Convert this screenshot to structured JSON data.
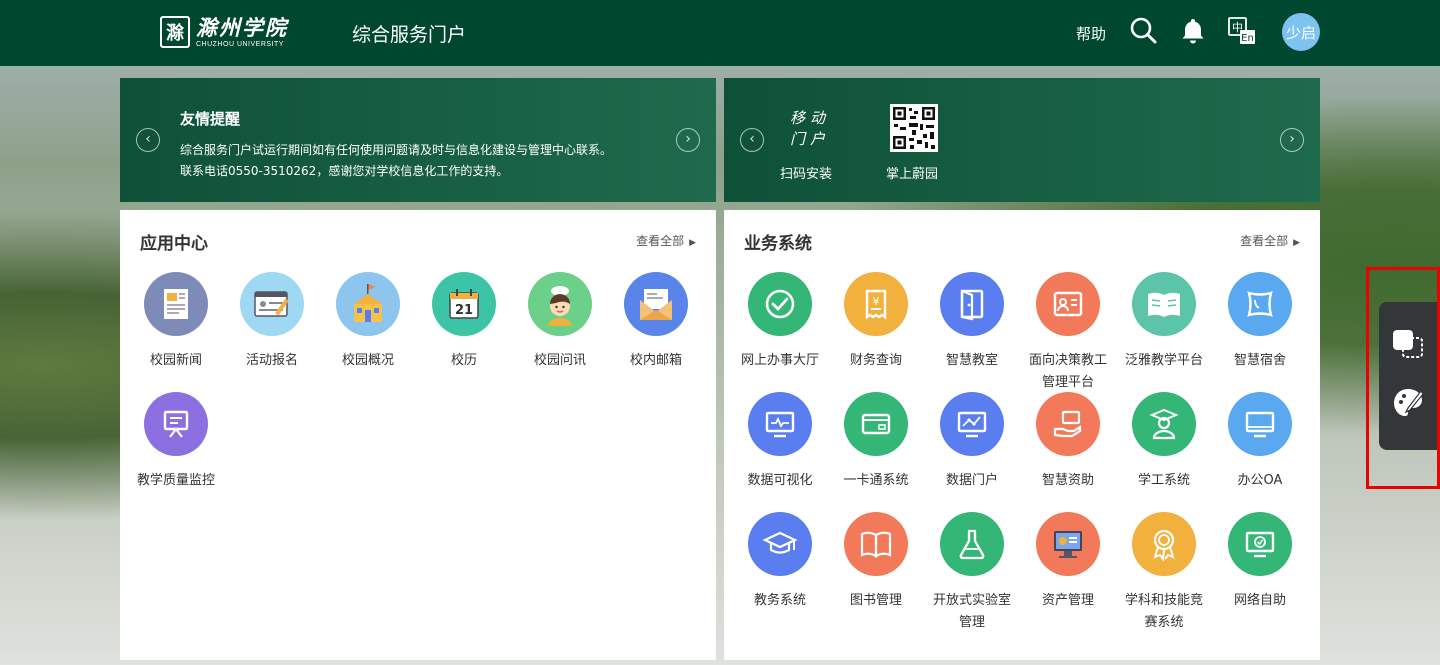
{
  "header": {
    "logo_cn": "滁州学院",
    "logo_en": "CHUZHOU UNIVERSITY",
    "logo_seal": "滁",
    "portal_title": "综合服务门户",
    "help": "帮助",
    "user_avatar": "少启",
    "icons": [
      "search-icon",
      "bell-icon",
      "language-icon"
    ]
  },
  "notice": {
    "title": "友情提醒",
    "line1": "综合服务门户试运行期间如有任何使用问题请及时与信息化建设与管理中心联系。",
    "line2": "联系电话0550-3510262，感谢您对学校信息化工作的支持。"
  },
  "mobile": {
    "slogan_line1": "移动",
    "slogan_line2": "门户",
    "scan_caption": "扫码安装",
    "app_caption": "掌上蔚园"
  },
  "app_center": {
    "title": "应用中心",
    "view_all": "查看全部",
    "apps": [
      {
        "label": "校园新闻",
        "icon": "newspaper-icon",
        "color": "#7e8ab8"
      },
      {
        "label": "活动报名",
        "icon": "signup-form-icon",
        "color": "#9fd8f2"
      },
      {
        "label": "校园概况",
        "icon": "school-building-icon",
        "color": "#8dc5ee"
      },
      {
        "label": "校历",
        "icon": "calendar-icon",
        "color": "#3cc4a8"
      },
      {
        "label": "校园问讯",
        "icon": "student-avatar-icon",
        "color": "#6bd08a"
      },
      {
        "label": "校内邮箱",
        "icon": "mail-envelope-icon",
        "color": "#5a84e8"
      },
      {
        "label": "教学质量监控",
        "icon": "teaching-board-icon",
        "color": "#8c6fe0"
      }
    ]
  },
  "business": {
    "title": "业务系统",
    "view_all": "查看全部",
    "apps": [
      {
        "label": "网上办事大厅",
        "icon": "check-circle-icon",
        "color": "#34b676"
      },
      {
        "label": "财务查询",
        "icon": "receipt-yen-icon",
        "color": "#f2b13c"
      },
      {
        "label": "智慧教室",
        "icon": "door-icon",
        "color": "#5a7ef0"
      },
      {
        "label": "面向决策教工管理平台",
        "icon": "staff-card-icon",
        "color": "#f27a5a"
      },
      {
        "label": "泛雅教学平台",
        "icon": "open-book-icon",
        "color": "#5cc4a8"
      },
      {
        "label": "智慧宿舍",
        "icon": "pillow-icon",
        "color": "#5aa8f0"
      },
      {
        "label": "数据可视化",
        "icon": "monitor-chart-icon",
        "color": "#5a7ef0"
      },
      {
        "label": "一卡通系统",
        "icon": "card-icon",
        "color": "#34b676"
      },
      {
        "label": "数据门户",
        "icon": "monitor-graph-icon",
        "color": "#5a7ef0"
      },
      {
        "label": "智慧资助",
        "icon": "hand-giving-icon",
        "color": "#f27a5a"
      },
      {
        "label": "学工系统",
        "icon": "graduate-icon",
        "color": "#34b676"
      },
      {
        "label": "办公OA",
        "icon": "desktop-icon",
        "color": "#5aa8f0"
      },
      {
        "label": "教务系统",
        "icon": "mortarboard-icon",
        "color": "#5a7ef0"
      },
      {
        "label": "图书管理",
        "icon": "book-icon",
        "color": "#f27a5a"
      },
      {
        "label": "开放式实验室管理",
        "icon": "flask-icon",
        "color": "#34b676"
      },
      {
        "label": "资产管理",
        "icon": "computer-screen-icon",
        "color": "#f27a5a"
      },
      {
        "label": "学科和技能竞赛系统",
        "icon": "medal-icon",
        "color": "#f2b13c"
      },
      {
        "label": "网络自助",
        "icon": "network-monitor-icon",
        "color": "#34b676"
      }
    ]
  },
  "side_tools": [
    "screenshot-tool-icon",
    "palette-icon"
  ]
}
